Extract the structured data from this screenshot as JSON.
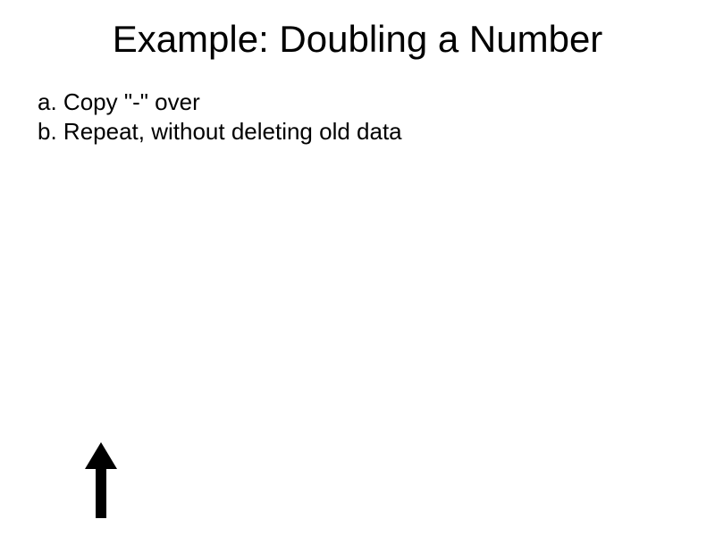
{
  "title": "Example: Doubling a Number",
  "items": [
    {
      "marker": "a. ",
      "text": "Copy \"-\" over"
    },
    {
      "marker": "b. ",
      "text": "Repeat, without deleting old data"
    }
  ],
  "icons": {
    "arrow": "up-arrow-icon"
  }
}
